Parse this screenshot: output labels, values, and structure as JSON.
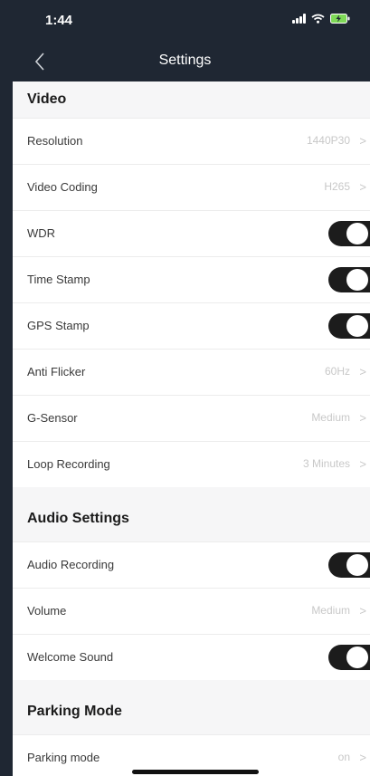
{
  "status_bar": {
    "time": "1:44"
  },
  "nav": {
    "title": "Settings"
  },
  "sections": {
    "video": {
      "title": "Video",
      "resolution": {
        "label": "Resolution",
        "value": "1440P30"
      },
      "video_coding": {
        "label": "Video Coding",
        "value": "H265"
      },
      "wdr": {
        "label": "WDR",
        "on": true
      },
      "time_stamp": {
        "label": "Time Stamp",
        "on": true
      },
      "gps_stamp": {
        "label": "GPS Stamp",
        "on": true
      },
      "anti_flicker": {
        "label": "Anti Flicker",
        "value": "60Hz"
      },
      "g_sensor": {
        "label": "G-Sensor",
        "value": "Medium"
      },
      "loop_recording": {
        "label": "Loop Recording",
        "value": "3 Minutes"
      }
    },
    "audio": {
      "title": "Audio Settings",
      "audio_recording": {
        "label": "Audio Recording",
        "on": true
      },
      "volume": {
        "label": "Volume",
        "value": "Medium"
      },
      "welcome_sound": {
        "label": "Welcome Sound",
        "on": true
      }
    },
    "parking": {
      "title": "Parking Mode",
      "parking_mode": {
        "label": "Parking mode",
        "value": "on"
      }
    }
  },
  "colors": {
    "header_bg": "#1f2733",
    "toggle_on": "#1c1c1c",
    "section_bg": "#f6f6f7",
    "value_text": "#c8c8c8"
  }
}
